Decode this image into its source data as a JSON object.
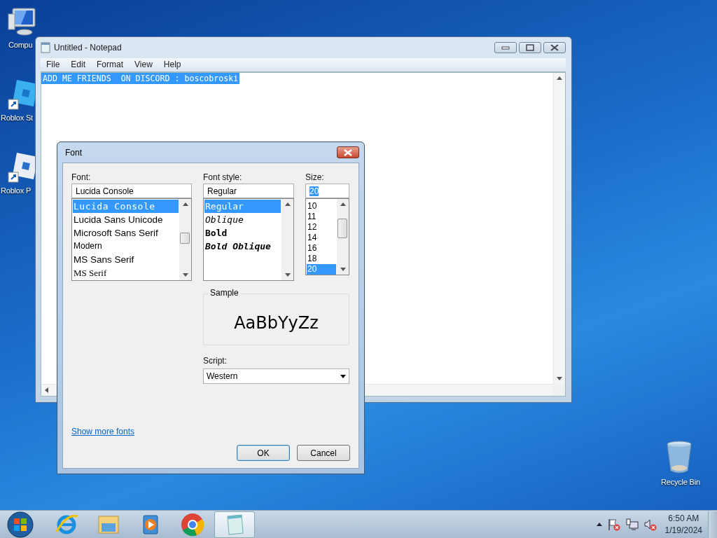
{
  "desktop": {
    "icons": [
      {
        "kind": "computer",
        "label": "Compu"
      },
      {
        "kind": "roblox-studio",
        "label": "Roblox St"
      },
      {
        "kind": "roblox-player",
        "label": "Roblox P"
      },
      {
        "kind": "recycle-bin",
        "label": "Recycle Bin"
      }
    ]
  },
  "notepad": {
    "title": "Untitled - Notepad",
    "menu": [
      "File",
      "Edit",
      "Format",
      "View",
      "Help"
    ],
    "text": "ADD ME FRIENDS  ON DISCORD : boscobroski",
    "text_selected": true
  },
  "font_dialog": {
    "title": "Font",
    "font": {
      "label": "Font:",
      "value": "Lucida Console",
      "items": [
        {
          "label": "Lucida Console",
          "kind": "mono",
          "selected": true
        },
        {
          "label": "Lucida Sans Unicode",
          "kind": "sans",
          "selected": false
        },
        {
          "label": "Microsoft Sans Serif",
          "kind": "sans",
          "selected": false
        },
        {
          "label": "Modern",
          "kind": "narrow",
          "selected": false
        },
        {
          "label": "MS Sans Serif",
          "kind": "sans",
          "selected": false
        },
        {
          "label": "MS Serif",
          "kind": "serif",
          "selected": false
        }
      ]
    },
    "style": {
      "label": "Font style:",
      "value": "Regular",
      "items": [
        {
          "label": "Regular",
          "kind": "regular",
          "selected": true
        },
        {
          "label": "Oblique",
          "kind": "oblique",
          "selected": false
        },
        {
          "label": "Bold",
          "kind": "bold",
          "selected": false
        },
        {
          "label": "Bold Oblique",
          "kind": "bold-oblique",
          "selected": false
        }
      ]
    },
    "size": {
      "label": "Size:",
      "value": "20",
      "value_selected": true,
      "items": [
        {
          "label": "10",
          "selected": false
        },
        {
          "label": "11",
          "selected": false
        },
        {
          "label": "12",
          "selected": false
        },
        {
          "label": "14",
          "selected": false
        },
        {
          "label": "16",
          "selected": false
        },
        {
          "label": "18",
          "selected": false
        },
        {
          "label": "20",
          "selected": true
        }
      ]
    },
    "sample": {
      "label": "Sample",
      "text": "AaBbYyZz"
    },
    "script": {
      "label": "Script:",
      "value": "Western"
    },
    "link": "Show more fonts",
    "buttons": [
      {
        "label": "OK",
        "default": true
      },
      {
        "label": "Cancel",
        "default": false
      }
    ]
  },
  "taskbar": {
    "items": [
      {
        "kind": "start",
        "selected": false
      },
      {
        "kind": "browser-e",
        "selected": false
      },
      {
        "kind": "folder",
        "selected": false
      },
      {
        "kind": "media-player",
        "selected": false
      },
      {
        "kind": "chrome",
        "selected": false
      },
      {
        "kind": "notepad",
        "selected": true
      }
    ],
    "clock": {
      "time": "6:50 AM",
      "date": "1/19/2024"
    }
  }
}
